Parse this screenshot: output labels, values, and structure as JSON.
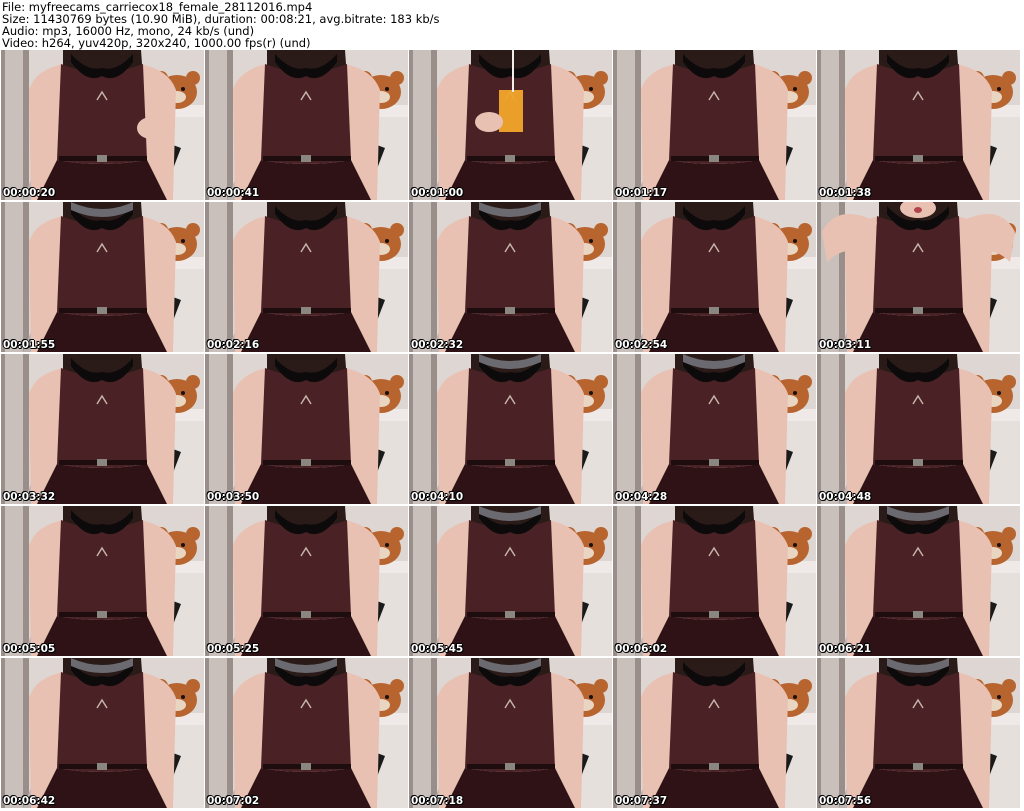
{
  "header": {
    "file_line": "File: myfreecams_carriecox18_female_28112016.mp4",
    "size_line": "Size: 11430769 bytes (10.90 MiB), duration: 00:08:21, avg.bitrate: 183 kb/s",
    "audio_line": "Audio: mp3, 16000 Hz, mono, 24 kb/s (und)",
    "video_line": "Video: h264, yuv420p, 320x240, 1000.00 fps(r) (und)"
  },
  "thumbnails": [
    {
      "timestamp": "00:00:20",
      "pose": "hand-raised",
      "mask": false
    },
    {
      "timestamp": "00:00:41",
      "pose": "neutral",
      "mask": false
    },
    {
      "timestamp": "00:01:00",
      "pose": "drinking",
      "mask": false
    },
    {
      "timestamp": "00:01:17",
      "pose": "neutral",
      "mask": false
    },
    {
      "timestamp": "00:01:38",
      "pose": "neutral",
      "mask": false
    },
    {
      "timestamp": "00:01:55",
      "pose": "neutral",
      "mask": true
    },
    {
      "timestamp": "00:02:16",
      "pose": "neutral",
      "mask": false
    },
    {
      "timestamp": "00:02:32",
      "pose": "neutral",
      "mask": true
    },
    {
      "timestamp": "00:02:54",
      "pose": "neutral",
      "mask": false
    },
    {
      "timestamp": "00:03:11",
      "pose": "arms-up",
      "mask": false
    },
    {
      "timestamp": "00:03:32",
      "pose": "neutral",
      "mask": false
    },
    {
      "timestamp": "00:03:50",
      "pose": "neutral",
      "mask": false
    },
    {
      "timestamp": "00:04:10",
      "pose": "neutral",
      "mask": true
    },
    {
      "timestamp": "00:04:28",
      "pose": "neutral",
      "mask": true
    },
    {
      "timestamp": "00:04:48",
      "pose": "neutral",
      "mask": false
    },
    {
      "timestamp": "00:05:05",
      "pose": "neutral",
      "mask": false
    },
    {
      "timestamp": "00:05:25",
      "pose": "neutral",
      "mask": false
    },
    {
      "timestamp": "00:05:45",
      "pose": "neutral",
      "mask": true
    },
    {
      "timestamp": "00:06:02",
      "pose": "neutral",
      "mask": false
    },
    {
      "timestamp": "00:06:21",
      "pose": "neutral",
      "mask": true
    },
    {
      "timestamp": "00:06:42",
      "pose": "neutral",
      "mask": true
    },
    {
      "timestamp": "00:07:02",
      "pose": "neutral",
      "mask": true
    },
    {
      "timestamp": "00:07:18",
      "pose": "neutral",
      "mask": true
    },
    {
      "timestamp": "00:07:37",
      "pose": "neutral",
      "mask": false
    },
    {
      "timestamp": "00:07:56",
      "pose": "neutral",
      "mask": true
    }
  ],
  "colors": {
    "wall": "#ddd6d2",
    "dress": "#4a2226",
    "dress_dark": "#2e1216",
    "skin": "#e9c1b3",
    "hair": "#2a1a18",
    "collar": "#0c0a0a",
    "bear": "#b8642e",
    "chair": "#1a1a1a",
    "mask": "#6a6a70",
    "drink": "#f2a62a"
  }
}
